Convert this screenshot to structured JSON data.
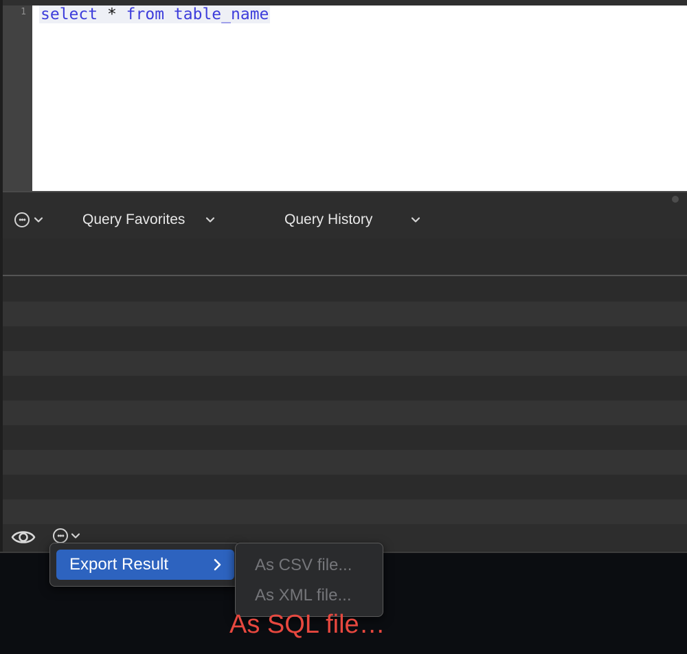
{
  "editor": {
    "line_number": "1",
    "code": {
      "kw1": "select",
      "op": "*",
      "kw2": "from",
      "ident": "table_name"
    }
  },
  "toolbar": {
    "favorites_label": "Query Favorites",
    "history_label": "Query History"
  },
  "context_menu": {
    "export_label": "Export Result",
    "submenu": [
      "As CSV file...",
      "As XML file..."
    ]
  },
  "overlay_text": "As SQL file…",
  "colors": {
    "keyword": "#3d3ddb",
    "menu_highlight": "#2d63bf",
    "overlay": "#e8483f"
  }
}
